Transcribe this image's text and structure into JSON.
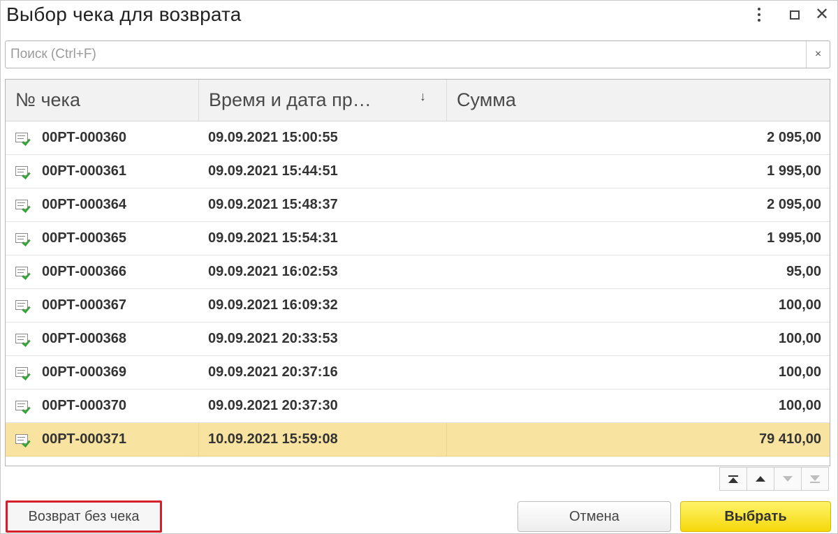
{
  "window": {
    "title": "Выбор чека для возврата"
  },
  "search": {
    "placeholder": "Поиск (Ctrl+F)",
    "value": "",
    "clear_label": "×"
  },
  "table": {
    "columns": [
      "№ чека",
      "Время и дата пр…",
      "Сумма"
    ],
    "sort_indicator": "↓",
    "rows": [
      {
        "number": "00РТ-000360",
        "datetime": "09.09.2021 15:00:55",
        "sum": "2 095,00"
      },
      {
        "number": "00РТ-000361",
        "datetime": "09.09.2021 15:44:51",
        "sum": "1 995,00"
      },
      {
        "number": "00РТ-000364",
        "datetime": "09.09.2021 15:48:37",
        "sum": "2 095,00"
      },
      {
        "number": "00РТ-000365",
        "datetime": "09.09.2021 15:54:31",
        "sum": "1 995,00"
      },
      {
        "number": "00РТ-000366",
        "datetime": "09.09.2021 16:02:53",
        "sum": "95,00"
      },
      {
        "number": "00РТ-000367",
        "datetime": "09.09.2021 16:09:32",
        "sum": "100,00"
      },
      {
        "number": "00РТ-000368",
        "datetime": "09.09.2021 20:33:53",
        "sum": "100,00"
      },
      {
        "number": "00РТ-000369",
        "datetime": "09.09.2021 20:37:16",
        "sum": "100,00"
      },
      {
        "number": "00РТ-000370",
        "datetime": "09.09.2021 20:37:30",
        "sum": "100,00"
      },
      {
        "number": "00РТ-000371",
        "datetime": "10.09.2021 15:59:08",
        "sum": "79 410,00"
      }
    ],
    "selected_row": 9
  },
  "buttons": {
    "no_receipt_return": "Возврат без чека",
    "cancel": "Отмена",
    "select": "Выбрать"
  },
  "colors": {
    "selected_row": "#f8e4a0",
    "primary_button": "#f5d80a",
    "highlight_border": "#d4202a",
    "check_mark": "#3aa03a"
  }
}
